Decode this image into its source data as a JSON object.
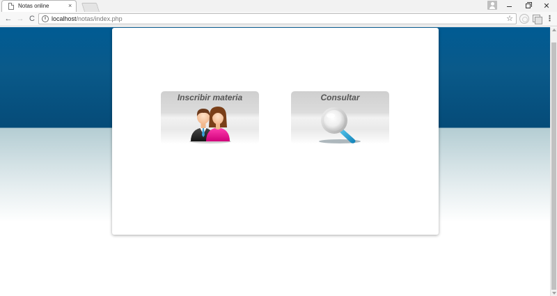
{
  "browser": {
    "tab_title": "Notas online",
    "tab_close": "×",
    "url_host": "localhost",
    "url_path": "/notas/index.php",
    "info_glyph": "i",
    "star_glyph": "☆",
    "back_glyph": "←",
    "forward_glyph": "→",
    "reload_glyph": "C",
    "menu_glyph": "⋮",
    "close_glyph": "✕",
    "icons": [
      "document-icon",
      "user-profile-icon",
      "info-icon",
      "star-icon",
      "extension-icon",
      "cast-icon",
      "menu-icon"
    ]
  },
  "main": {
    "tiles": [
      {
        "label": "Inscribir materia",
        "icon": "users-icon"
      },
      {
        "label": "Consultar",
        "icon": "magnifier-icon"
      }
    ]
  },
  "colors": {
    "header_blue": "#005b93",
    "magenta": "#e8138f",
    "magnifier_blue": "#1f9fd2"
  }
}
